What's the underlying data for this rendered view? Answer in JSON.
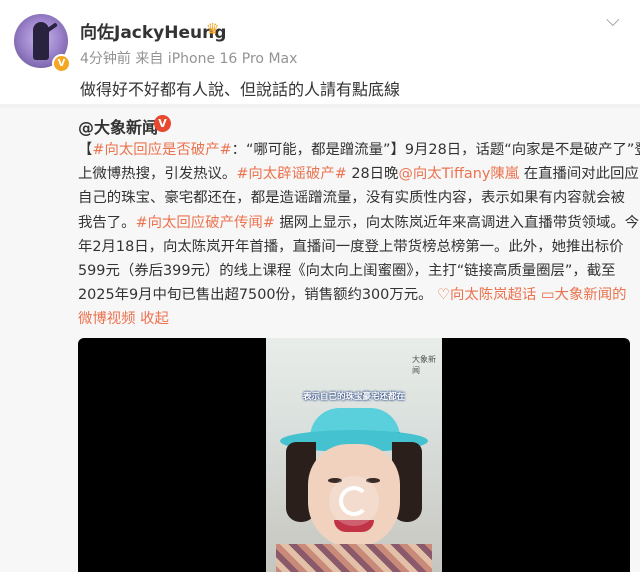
{
  "post": {
    "user_name": "向佐JackyHeung",
    "meta": "4分钟前  来自 iPhone 16 Pro Max",
    "text": "做得好不好都有人說、但說話的人請有點底線"
  },
  "repost": {
    "source_name": "@大象新闻",
    "lines": [
      [
        {
          "t": "【",
          "c": ""
        },
        {
          "t": "#向太回应是否破产#",
          "c": "tag"
        },
        {
          "t": "：“哪可能，都是蹭流量”】9月28日，话题“向家是不是破产了”登",
          "c": ""
        }
      ],
      [
        {
          "t": "上微博热搜，引发热议。",
          "c": ""
        },
        {
          "t": "#向太辟谣破产#",
          "c": "tag"
        },
        {
          "t": " 28日晚",
          "c": ""
        },
        {
          "t": "@向太Tiffany陳嵐",
          "c": "mention"
        },
        {
          "t": " 在直播间对此回应",
          "c": ""
        }
      ],
      [
        {
          "t": "自己的珠宝、豪宅都还在，都是造谣蹭流量，没有实质性内容，表示如果有内容就会被",
          "c": ""
        }
      ],
      [
        {
          "t": "我告了。",
          "c": ""
        },
        {
          "t": "#向太回应破产传闻#",
          "c": "tag"
        },
        {
          "t": " 据网上显示，向太陈岚近年来高调进入直播带货领域。今",
          "c": ""
        }
      ],
      [
        {
          "t": "年2月18日，向太陈岚开年首播，直播间一度登上带货榜总榜第一。此外，她推出标价",
          "c": ""
        }
      ],
      [
        {
          "t": "599元（券后399元）的线上课程《向太向上闺蜜圈》，主打“链接高质量圈层”，截至",
          "c": ""
        }
      ],
      [
        {
          "t": "2025年9月中旬已售出超7500份，销售额约300万元。 ",
          "c": ""
        },
        {
          "t": "♡",
          "c": "link"
        },
        {
          "t": "向太陈岚超话",
          "c": "link"
        },
        {
          "t": " ",
          "c": ""
        },
        {
          "t": "▭",
          "c": "link"
        },
        {
          "t": "大象新闻的",
          "c": "link"
        }
      ],
      [
        {
          "t": "微博视频",
          "c": "link"
        },
        {
          "t": "  ",
          "c": ""
        },
        {
          "t": "收起",
          "c": "link"
        }
      ]
    ]
  },
  "video": {
    "logo_text": "大象新闻",
    "caption": "表示自己的珠宝豪宅还都在"
  },
  "colors": {
    "accent": "#eb7350",
    "meta_gray": "#939393",
    "repost_bg": "#f7f7f7"
  },
  "icons": {
    "more": "chevron-down-icon",
    "verified": "verified-badge-icon",
    "crown": "crown-icon",
    "source_badge": "media-badge-icon",
    "play": "replay-icon"
  }
}
